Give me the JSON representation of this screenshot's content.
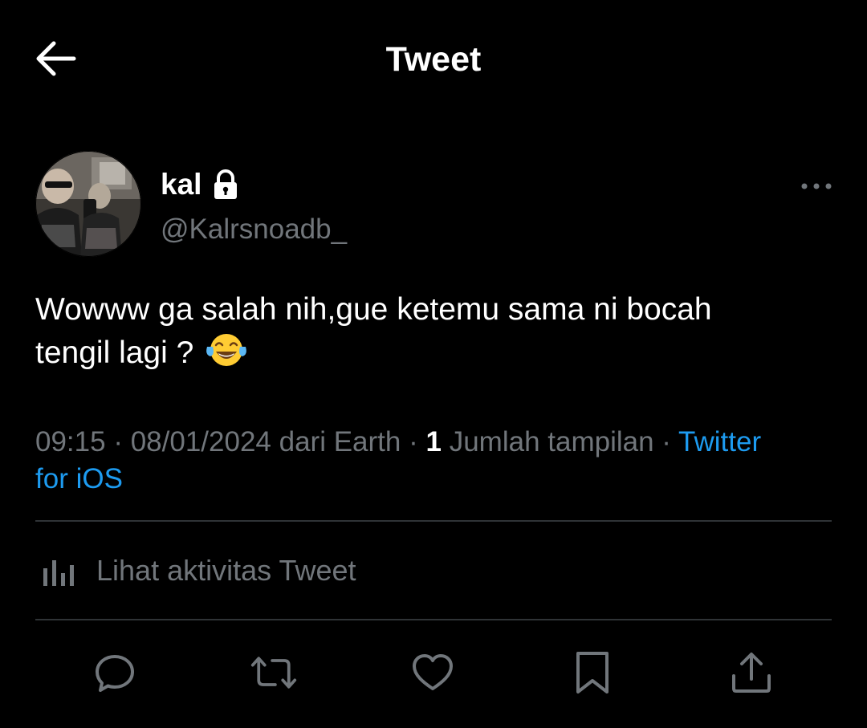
{
  "header": {
    "back_icon": "arrow-left-icon",
    "title": "Tweet"
  },
  "author": {
    "display_name": "kal",
    "protected_icon": "lock-icon",
    "handle": "@Kalrsnoadb_",
    "avatar": "profile-photo"
  },
  "tweet": {
    "text_line1": "Wowww ga salah nih,gue ketemu sama ni bocah",
    "text_line2": "tengil lagi ?",
    "emoji": "face-with-tears-of-joy"
  },
  "meta": {
    "time": "09:15",
    "date": "08/01/2024",
    "location": "dari Earth",
    "views_count": "1",
    "views_label": "Jumlah tampilan",
    "source_line1": "Twitter",
    "source_line2": "for iOS",
    "separator": "·"
  },
  "activity": {
    "icon": "bar-chart-icon",
    "label": "Lihat aktivitas Tweet"
  },
  "actions": {
    "reply_icon": "reply-icon",
    "retweet_icon": "retweet-icon",
    "like_icon": "heart-icon",
    "bookmark_icon": "bookmark-icon",
    "share_icon": "share-icon"
  },
  "colors": {
    "background": "#000000",
    "text_primary": "#ffffff",
    "text_secondary": "#71767b",
    "accent": "#1d9bf0",
    "divider": "#2f3336"
  }
}
